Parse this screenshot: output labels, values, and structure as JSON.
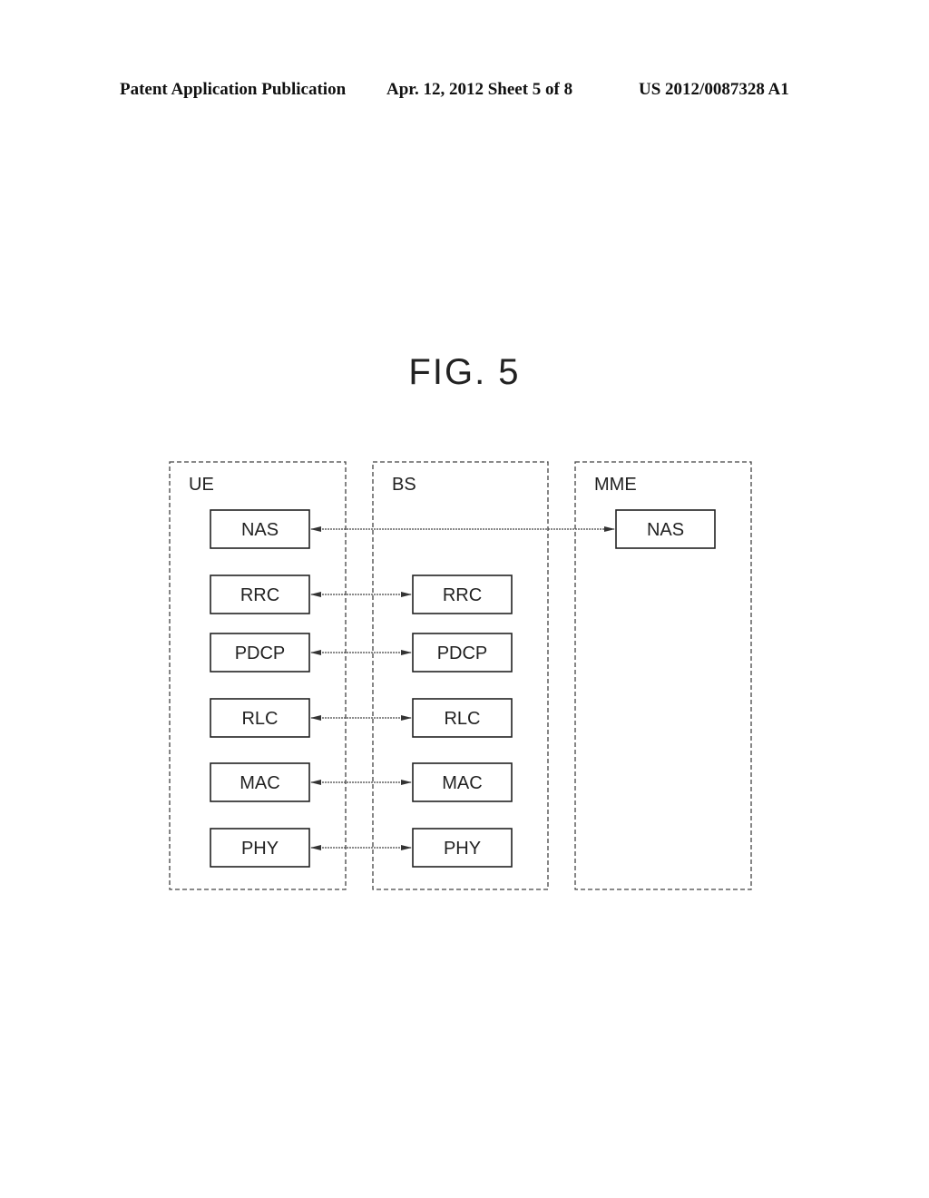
{
  "header": {
    "publication": "Patent Application Publication",
    "date_sheet": "Apr. 12, 2012  Sheet 5 of 8",
    "number": "US 2012/0087328 A1"
  },
  "figure": {
    "title": "FIG. 5",
    "entities": [
      {
        "label": "UE",
        "layers": [
          "NAS",
          "RRC",
          "PDCP",
          "RLC",
          "MAC",
          "PHY"
        ]
      },
      {
        "label": "BS",
        "layers": [
          "RRC",
          "PDCP",
          "RLC",
          "MAC",
          "PHY"
        ]
      },
      {
        "label": "MME",
        "layers": [
          "NAS"
        ]
      }
    ],
    "links": [
      {
        "from": "UE.NAS",
        "to": "MME.NAS"
      },
      {
        "from": "UE.RRC",
        "to": "BS.RRC"
      },
      {
        "from": "UE.PDCP",
        "to": "BS.PDCP"
      },
      {
        "from": "UE.RLC",
        "to": "BS.RLC"
      },
      {
        "from": "UE.MAC",
        "to": "BS.MAC"
      },
      {
        "from": "UE.PHY",
        "to": "BS.PHY"
      }
    ]
  }
}
